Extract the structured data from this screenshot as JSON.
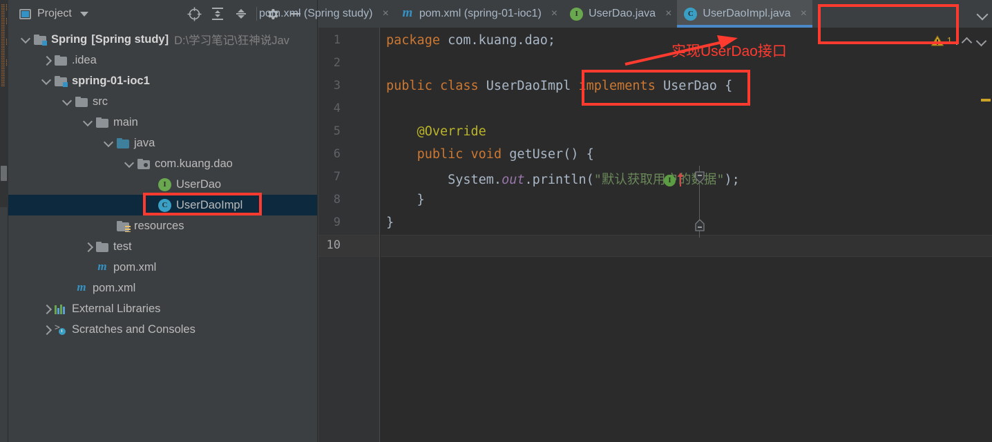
{
  "window": {
    "theme_bg": "#3c3f41",
    "editor_bg": "#2b2b2b",
    "accent": "#3592c4",
    "annotation_color": "#ff3b30"
  },
  "project_panel": {
    "title": "Project",
    "icons": {
      "project_icon": "project-window-icon",
      "dropdown": "chevron-down-icon",
      "locate": "locate-target-icon",
      "expand_all": "expand-all-icon",
      "collapse_all": "collapse-all-icon",
      "settings": "gear-icon",
      "hide": "minimize-icon"
    },
    "tree": [
      {
        "label": "Spring",
        "suffix": "[Spring study]",
        "path": "D:\\学习笔记\\狂神说Jav",
        "icon": "module-folder-icon",
        "depth": 0,
        "arrow": "down",
        "bold": true
      },
      {
        "label": ".idea",
        "icon": "folder-icon",
        "depth": 1,
        "arrow": "right",
        "bold": false
      },
      {
        "label": "spring-01-ioc1",
        "icon": "module-folder-icon",
        "depth": 1,
        "arrow": "down",
        "bold": true
      },
      {
        "label": "src",
        "icon": "folder-icon",
        "depth": 2,
        "arrow": "down",
        "bold": false
      },
      {
        "label": "main",
        "icon": "folder-icon",
        "depth": 3,
        "arrow": "down",
        "bold": false
      },
      {
        "label": "java",
        "icon": "source-folder-icon",
        "depth": 4,
        "arrow": "down",
        "bold": false
      },
      {
        "label": "com.kuang.dao",
        "icon": "package-icon",
        "depth": 5,
        "arrow": "down",
        "bold": false
      },
      {
        "label": "UserDao",
        "icon": "interface-icon",
        "depth": 6,
        "arrow": "none",
        "bold": false
      },
      {
        "label": "UserDaoImpl",
        "icon": "class-icon",
        "depth": 6,
        "arrow": "none",
        "bold": false,
        "selected": true,
        "highlighted": true
      },
      {
        "label": "resources",
        "icon": "resources-folder-icon",
        "depth": 4,
        "arrow": "none",
        "bold": false
      },
      {
        "label": "test",
        "icon": "folder-icon",
        "depth": 3,
        "arrow": "right",
        "bold": false
      },
      {
        "label": "pom.xml",
        "icon": "maven-icon",
        "depth": 3,
        "arrow": "none",
        "bold": false
      },
      {
        "label": "pom.xml",
        "icon": "maven-icon",
        "depth": 2,
        "arrow": "none",
        "bold": false
      },
      {
        "label": "External Libraries",
        "icon": "libraries-icon",
        "depth": 1,
        "arrow": "right",
        "bold": false
      },
      {
        "label": "Scratches and Consoles",
        "icon": "scratches-icon",
        "depth": 1,
        "arrow": "right",
        "bold": false
      }
    ]
  },
  "editor_tabs": {
    "tabs": [
      {
        "label": "pom.xml (Spring study)",
        "icon": "maven-icon",
        "active": false,
        "truncated": true,
        "close": "×"
      },
      {
        "label": "pom.xml (spring-01-ioc1)",
        "icon": "maven-icon",
        "active": false,
        "close": "×"
      },
      {
        "label": "UserDao.java",
        "icon": "interface-icon",
        "active": false,
        "close": "×"
      },
      {
        "label": "UserDaoImpl.java",
        "icon": "class-icon",
        "active": true,
        "close": "×",
        "highlighted": true
      }
    ],
    "overflow_icon": "chevron-down-icon"
  },
  "editor": {
    "line_numbers": [
      "1",
      "2",
      "3",
      "4",
      "5",
      "6",
      "7",
      "8",
      "9",
      "10"
    ],
    "current_line": 10,
    "lines": [
      {
        "n": 1,
        "tokens": [
          {
            "t": "package ",
            "c": "kw"
          },
          {
            "t": "com.kuang.dao;",
            "c": "plain"
          }
        ]
      },
      {
        "n": 2,
        "tokens": []
      },
      {
        "n": 3,
        "tokens": [
          {
            "t": "public class ",
            "c": "kw"
          },
          {
            "t": "UserDaoImpl ",
            "c": "plain"
          },
          {
            "t": "implements ",
            "c": "kw"
          },
          {
            "t": "UserDao",
            "c": "plain"
          },
          {
            "t": " {",
            "c": "plain"
          }
        ]
      },
      {
        "n": 4,
        "tokens": []
      },
      {
        "n": 5,
        "tokens": [
          {
            "t": "    @Override",
            "c": "ann"
          }
        ]
      },
      {
        "n": 6,
        "tokens": [
          {
            "t": "    ",
            "c": "plain"
          },
          {
            "t": "public void ",
            "c": "kw"
          },
          {
            "t": "getUser",
            "c": "plain"
          },
          {
            "t": "() {",
            "c": "plain"
          }
        ]
      },
      {
        "n": 7,
        "tokens": [
          {
            "t": "        System.",
            "c": "plain"
          },
          {
            "t": "out",
            "c": "fld"
          },
          {
            "t": ".println(",
            "c": "plain"
          },
          {
            "t": "\"默认获取用户的数据\"",
            "c": "str"
          },
          {
            "t": ");",
            "c": "plain"
          }
        ]
      },
      {
        "n": 8,
        "tokens": [
          {
            "t": "    }",
            "c": "plain"
          }
        ]
      },
      {
        "n": 9,
        "tokens": [
          {
            "t": "}",
            "c": "plain"
          }
        ]
      },
      {
        "n": 10,
        "tokens": []
      }
    ],
    "gutter_icons": [
      {
        "line": 6,
        "icon": "implementing-method-icon",
        "letter": "I"
      },
      {
        "line": 6,
        "icon": "overriding-method-arrow-icon"
      },
      {
        "line": 6,
        "icon": "fold-collapse-icon"
      },
      {
        "line": 8,
        "icon": "fold-end-icon"
      }
    ]
  },
  "inspection_widget": {
    "warning_icon": "warning-triangle-icon",
    "count": "1",
    "prev_icon": "chevron-up-icon",
    "next_icon": "chevron-down-icon",
    "marker_color": "#c9a227"
  },
  "annotations": [
    {
      "type": "text",
      "text": "实现UserDao接口",
      "color": "#ff3b30"
    },
    {
      "type": "arrow",
      "name": "pointer-arrow"
    },
    {
      "type": "box",
      "name": "implements-userdao-highlight-box"
    },
    {
      "type": "box",
      "name": "tab-userdaoimpl-highlight-box"
    },
    {
      "type": "box",
      "name": "tree-userdaoimpl-highlight-box"
    }
  ]
}
